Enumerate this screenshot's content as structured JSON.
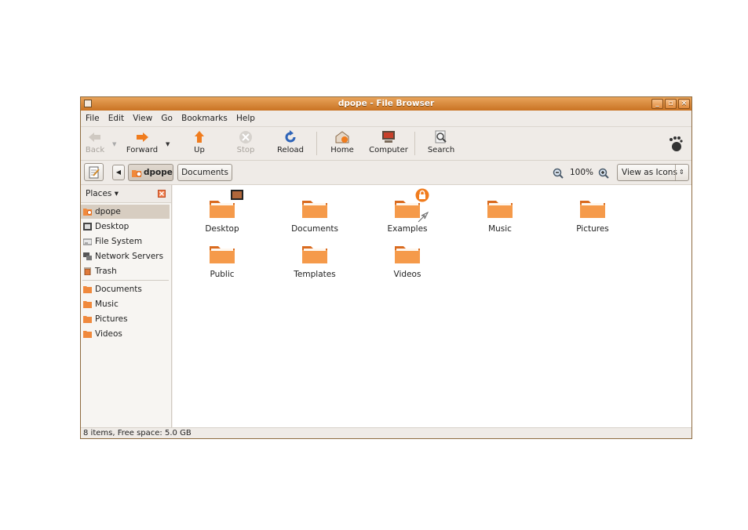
{
  "window": {
    "title": "dpope - File Browser"
  },
  "menu": [
    "File",
    "Edit",
    "View",
    "Go",
    "Bookmarks",
    "Help"
  ],
  "toolbar": {
    "back": "Back",
    "forward": "Forward",
    "up": "Up",
    "stop": "Stop",
    "reload": "Reload",
    "home": "Home",
    "computer": "Computer",
    "search": "Search"
  },
  "location": {
    "crumbs": [
      "dpope",
      "Documents"
    ],
    "zoom": "100%",
    "view_mode": "View as Icons"
  },
  "sidebar": {
    "header": "Places",
    "items": [
      "dpope",
      "Desktop",
      "File System",
      "Network Servers",
      "Trash"
    ],
    "bookmarks": [
      "Documents",
      "Music",
      "Pictures",
      "Videos"
    ]
  },
  "files": [
    "Desktop",
    "Documents",
    "Examples",
    "Music",
    "Pictures",
    "Public",
    "Templates",
    "Videos"
  ],
  "status": "8 items, Free space: 5.0 GB",
  "colors": {
    "titlebar": "#d98a3a",
    "folder": "#f0893c",
    "selection": "#d7cdc1"
  }
}
